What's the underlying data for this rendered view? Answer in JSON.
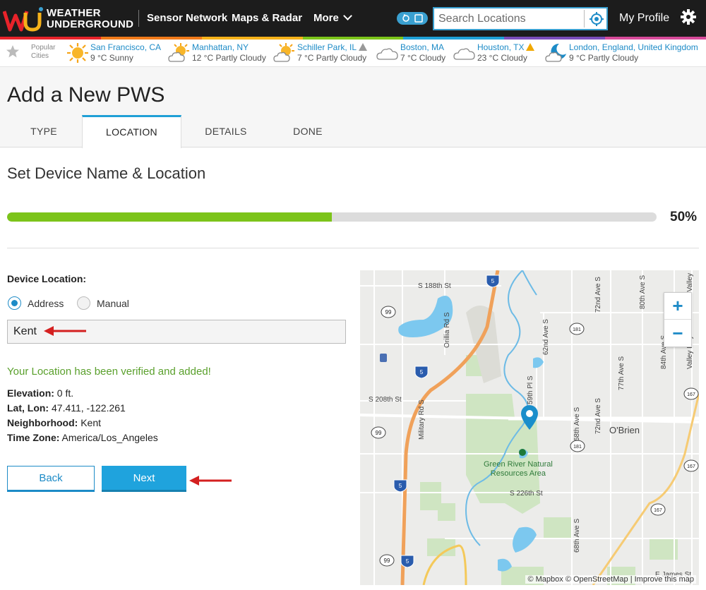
{
  "header": {
    "logo_line1": "WEATHER",
    "logo_line2": "UNDERGROUND",
    "nav": [
      "Sensor Network",
      "Maps & Radar",
      "More"
    ],
    "search_placeholder": "Search Locations",
    "profile": "My Profile",
    "colors": {
      "bar_bg": "#1c1c1c",
      "accent": "#3aa0d0"
    }
  },
  "popular_cities": {
    "label_line1": "Popular",
    "label_line2": "Cities",
    "items": [
      {
        "name": "San Francisco, CA",
        "weather": "9 °C Sunny",
        "icon": "sun-icon"
      },
      {
        "name": "Manhattan, NY",
        "weather": "12 °C Partly Cloudy",
        "icon": "partly-cloudy-icon"
      },
      {
        "name": "Schiller Park, IL",
        "weather": "7 °C Partly Cloudy",
        "icon": "partly-cloudy-icon",
        "alert": "gray"
      },
      {
        "name": "Boston, MA",
        "weather": "7 °C Cloudy",
        "icon": "cloud-icon"
      },
      {
        "name": "Houston, TX",
        "weather": "23 °C Cloudy",
        "icon": "cloud-icon",
        "alert": "orange"
      },
      {
        "name": "London, England, United Kingdom",
        "weather": "9 °C Partly Cloudy",
        "icon": "moon-cloud-icon"
      }
    ]
  },
  "page": {
    "title": "Add a New PWS",
    "tabs": [
      "TYPE",
      "LOCATION",
      "DETAILS",
      "DONE"
    ],
    "active_tab": "LOCATION"
  },
  "form": {
    "section_title": "Set Device Name & Location",
    "progress_percent": 50,
    "progress_label": "50%",
    "device_location_label": "Device Location:",
    "radio_address": "Address",
    "radio_manual": "Manual",
    "selected_mode": "Address",
    "address_value": "Kent",
    "verified_message": "Your Location has been verified and added!",
    "elevation_label": "Elevation:",
    "elevation_value": "0 ft.",
    "latlon_label": "Lat, Lon:",
    "latlon_value": "47.411, -122.261",
    "neighborhood_label": "Neighborhood:",
    "neighborhood_value": "Kent",
    "timezone_label": "Time Zone:",
    "timezone_value": "America/Los_Angeles",
    "back_label": "Back",
    "next_label": "Next",
    "annotation_color": "#d42020"
  },
  "map": {
    "zoom_in": "+",
    "zoom_out": "−",
    "attribution_mapbox": "© Mapbox",
    "attribution_osm": "© OpenStreetMap",
    "attribution_improve": "Improve this map",
    "place_label": "O'Brien",
    "park_label_line1": "Green River Natural",
    "park_label_line2": "Resources Area",
    "streets": {
      "s188": "S 188th St",
      "s208": "S 208th St",
      "s226": "S 226th St",
      "military": "Military Rd S",
      "orillia": "Orillia Rd S",
      "ave62": "62nd Ave S",
      "pl59": "59th Pl S",
      "ave68a": "68th Ave S",
      "ave68b": "68th Ave S",
      "ave72a": "72nd Ave S",
      "ave72b": "72nd Ave S",
      "ave77": "77th Ave S",
      "ave80": "80th Ave S",
      "ave84": "84th Ave S",
      "valley": "Valley Fwy",
      "emeeker": "E James St",
      "e_valley": "E Valley"
    },
    "shields": {
      "i5a": "5",
      "i5b": "5",
      "i5c": "5",
      "i5d": "5",
      "r99a": "99",
      "r99b": "99",
      "r99c": "99",
      "r181a": "181",
      "r181b": "181",
      "r167a": "167",
      "r167b": "167",
      "r167c": "167"
    }
  }
}
